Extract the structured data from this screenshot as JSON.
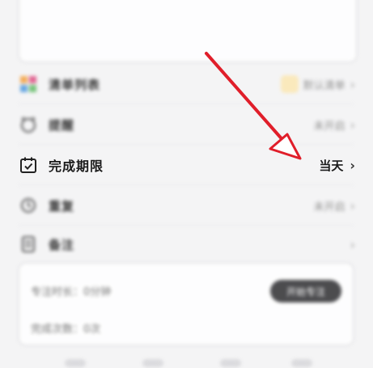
{
  "rows": {
    "list": {
      "label": "清单列表",
      "value": "默认清单"
    },
    "reminder": {
      "label": "提醒",
      "value": "未开启"
    },
    "due": {
      "label": "完成期限",
      "value": "当天"
    },
    "repeat": {
      "label": "重复",
      "value": "未开启"
    },
    "notes": {
      "label": "备注"
    }
  },
  "bottom_card": {
    "line1": "专注时长：0分钟",
    "line2": "完成次数：0次",
    "button": "开始专注"
  },
  "colors": {
    "annotation_arrow": "#e01e2a"
  }
}
